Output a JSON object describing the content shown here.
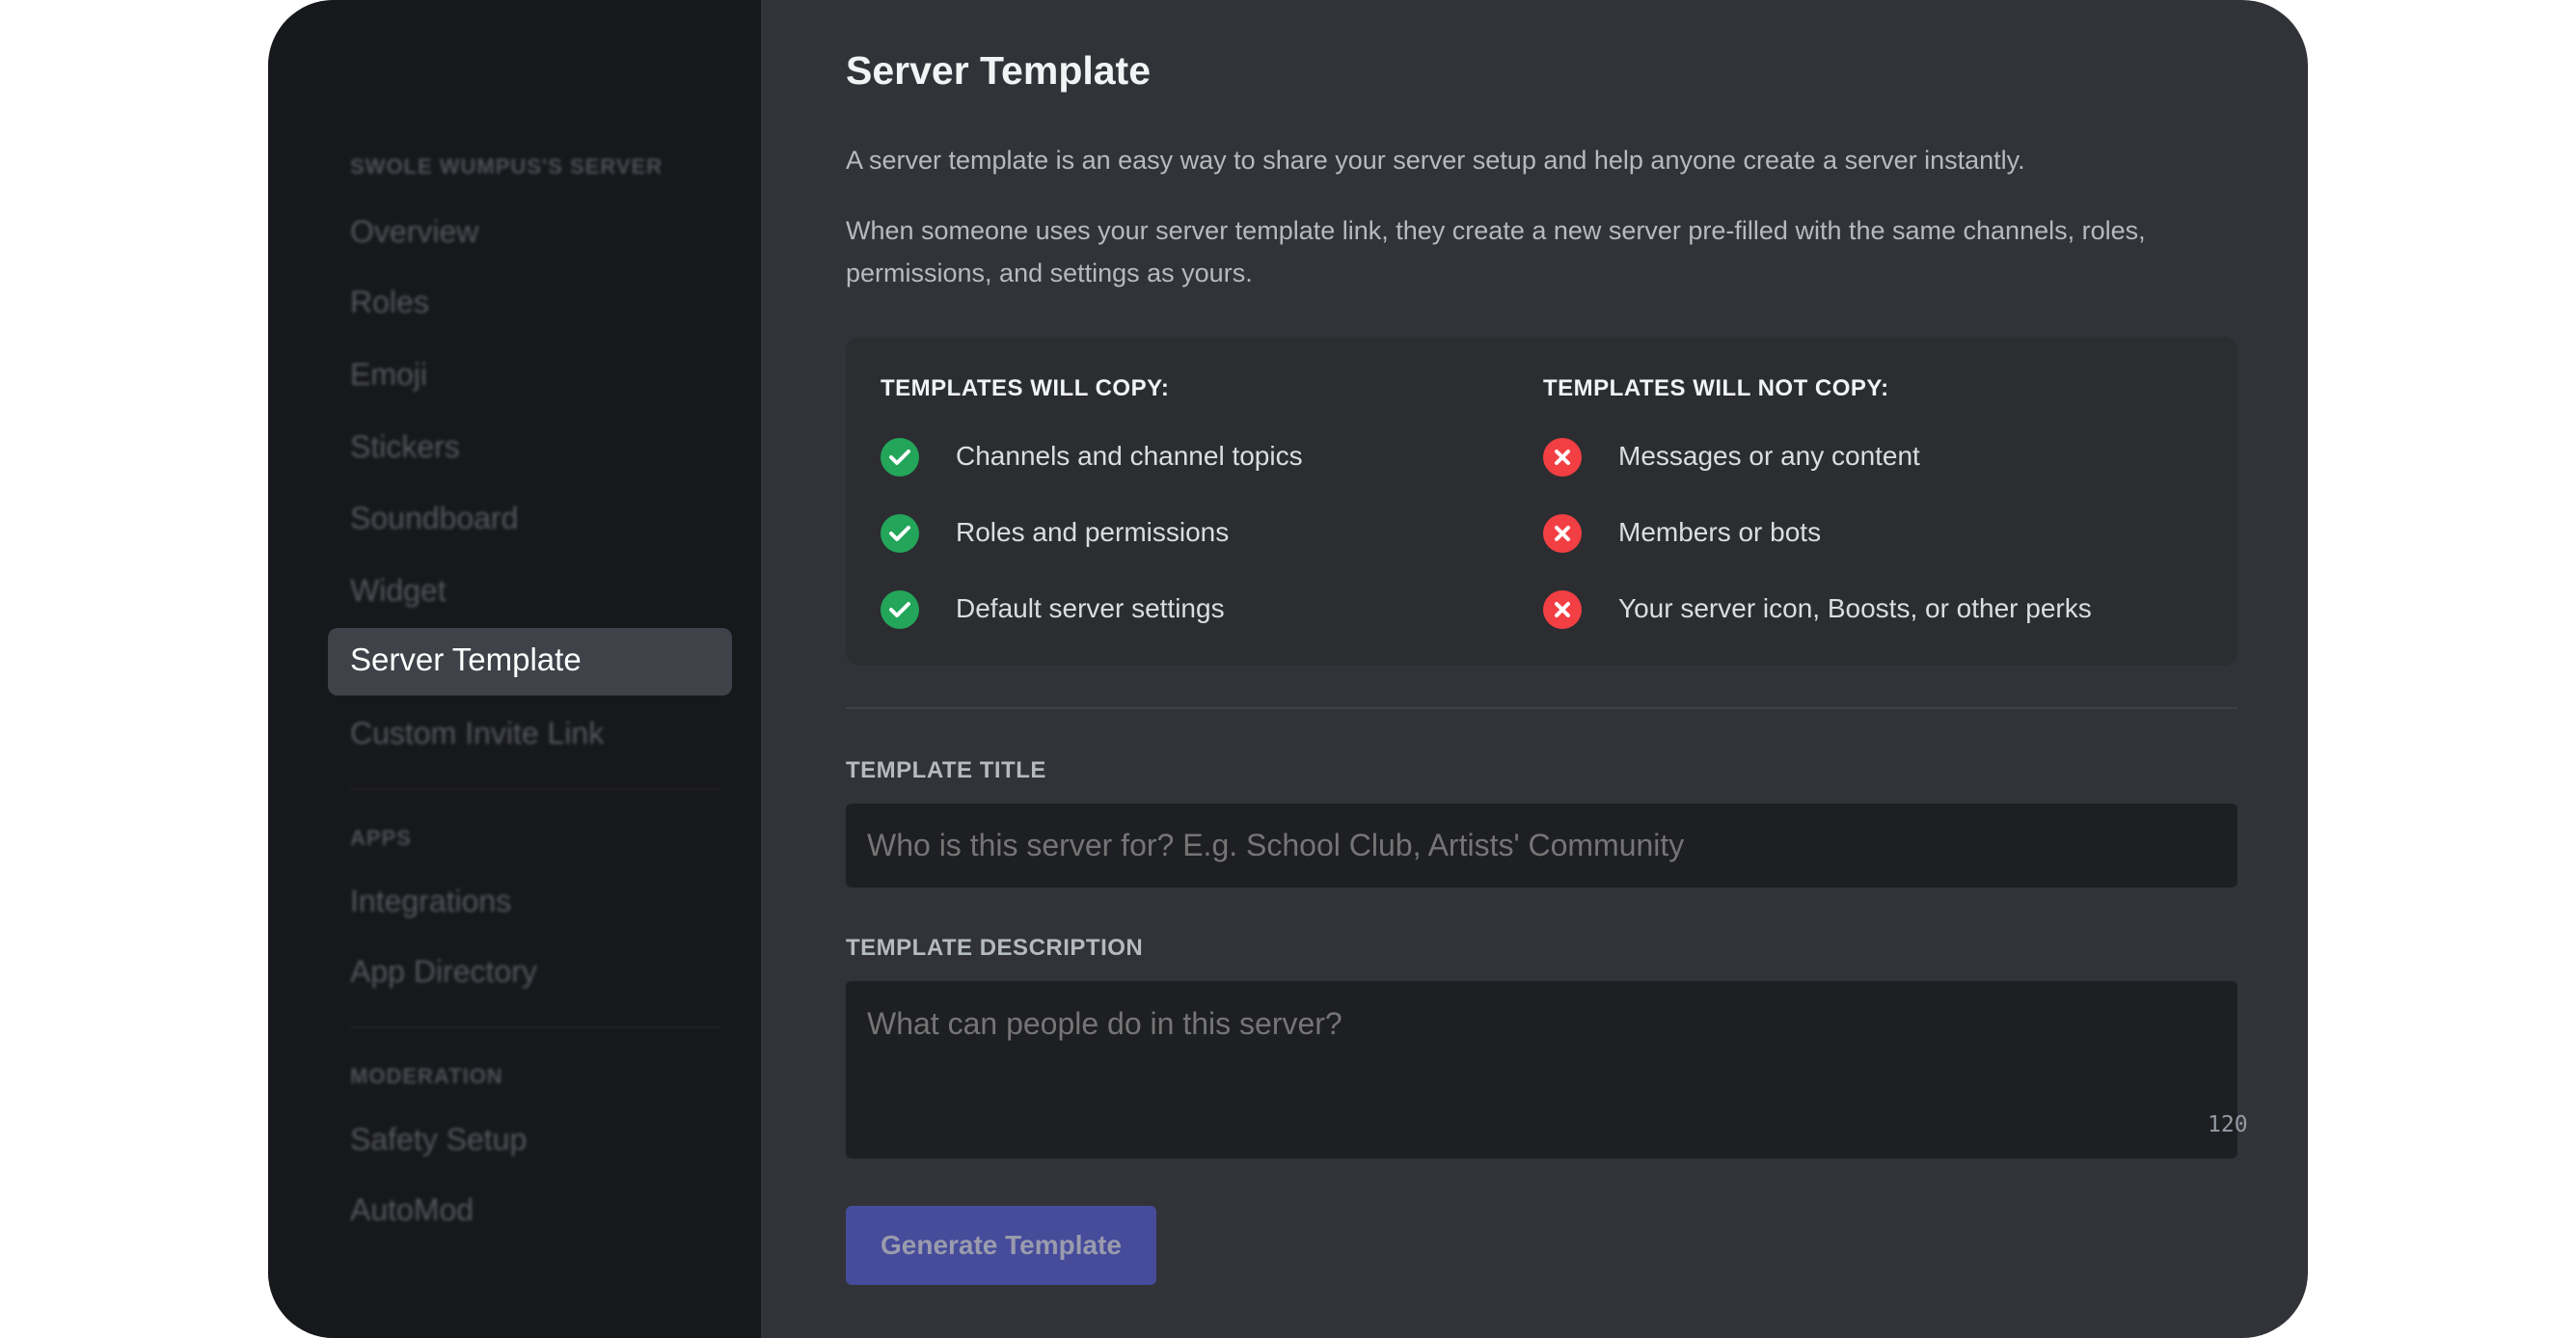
{
  "sidebar": {
    "server_header": "SWOLE WUMPUS'S SERVER",
    "server_items": [
      "Overview",
      "Roles",
      "Emoji",
      "Stickers",
      "Soundboard",
      "Widget",
      "Server Template",
      "Custom Invite Link"
    ],
    "apps_header": "APPS",
    "apps_items": [
      "Integrations",
      "App Directory"
    ],
    "moderation_header": "MODERATION",
    "moderation_items": [
      "Safety Setup",
      "AutoMod"
    ],
    "selected": "Server Template"
  },
  "main": {
    "title": "Server Template",
    "intro": "A server template is an easy way to share your server setup and help anyone create a server instantly.",
    "intro2": "When someone uses your server template link, they create a new server pre-filled with the same channels, roles, permissions, and settings as yours.",
    "will_copy": {
      "heading": "TEMPLATES WILL COPY:",
      "items": [
        "Channels and channel topics",
        "Roles and permissions",
        "Default server settings"
      ],
      "icon": "check-circle-icon",
      "color": "#23a55a"
    },
    "will_not_copy": {
      "heading": "TEMPLATES WILL NOT COPY:",
      "items": [
        "Messages or any content",
        "Members or bots",
        "Your server icon, Boosts, or other perks"
      ],
      "icon": "x-circle-icon",
      "color": "#f23f43"
    },
    "title_field": {
      "label": "TEMPLATE TITLE",
      "value": "",
      "placeholder": "Who is this server for? E.g. School Club, Artists' Community"
    },
    "description_field": {
      "label": "TEMPLATE DESCRIPTION",
      "value": "",
      "placeholder": "What can people do in this server?",
      "counter": "120"
    },
    "generate_button": "Generate Template"
  }
}
